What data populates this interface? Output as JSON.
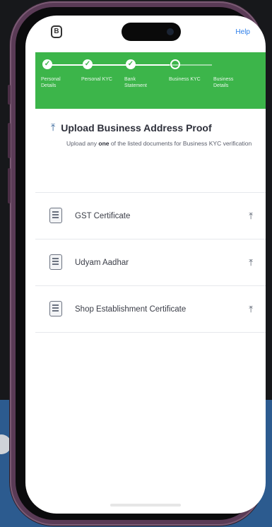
{
  "app": {
    "logo_text": "B",
    "help_label": "Help"
  },
  "progress": {
    "steps": [
      {
        "label": "Personal Details",
        "status": "done"
      },
      {
        "label": "Personal KYC",
        "status": "done"
      },
      {
        "label": "Bank Statement",
        "status": "done"
      },
      {
        "label": "Business KYC",
        "status": "current"
      },
      {
        "label": "Business Details",
        "status": "pending"
      }
    ]
  },
  "upload_section": {
    "title": "Upload Business Address Proof",
    "subtitle_prefix": "Upload any ",
    "subtitle_emphasis": "one",
    "subtitle_suffix": " of the listed documents for Business KYC verification"
  },
  "documents": [
    {
      "name": "GST Certificate"
    },
    {
      "name": "Udyam Aadhar"
    },
    {
      "name": "Shop Establishment Certificate"
    }
  ],
  "colors": {
    "accent_green": "#3cb54a",
    "link_blue": "#2b7de9",
    "backdrop_blue": "#2c5b8f",
    "phone_frame": "#5a3b56"
  },
  "icons": {
    "upload": "upload-icon",
    "document": "document-icon",
    "check": "check-icon"
  }
}
